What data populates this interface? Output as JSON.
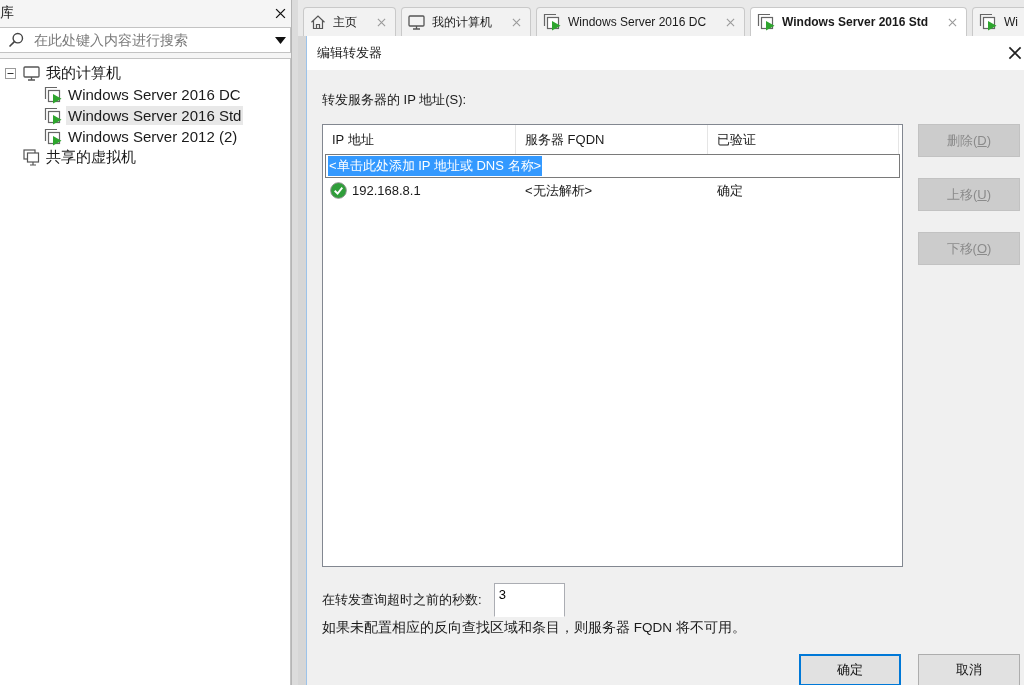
{
  "library_panel": {
    "title": "库",
    "search": {
      "placeholder": "在此处键入内容进行搜索"
    },
    "tree": [
      {
        "label": "我的计算机",
        "kind": "computer",
        "expanded": true,
        "selected": false,
        "children": [
          {
            "label": "Windows Server 2016 DC",
            "kind": "vm",
            "selected": false
          },
          {
            "label": "Windows Server 2016 Std",
            "kind": "vm",
            "selected": true
          },
          {
            "label": "Windows Server 2012 (2)",
            "kind": "vm",
            "selected": false
          }
        ]
      },
      {
        "label": "共享的虚拟机",
        "kind": "shared",
        "selected": false
      }
    ]
  },
  "tabs": [
    {
      "label": "主页",
      "kind": "home",
      "selected": false,
      "closable": true
    },
    {
      "label": "我的计算机",
      "kind": "computer",
      "selected": false,
      "closable": true
    },
    {
      "label": "Windows Server 2016 DC",
      "kind": "vm",
      "selected": false,
      "closable": true
    },
    {
      "label": "Windows Server 2016 Std",
      "kind": "vm",
      "selected": true,
      "closable": true
    },
    {
      "label": "Wi",
      "kind": "vm",
      "selected": false
    }
  ],
  "dialog": {
    "title": "编辑转发器",
    "list_label": "转发服务器的 IP 地址(S):",
    "columns": [
      "IP 地址",
      "服务器 FQDN",
      "已验证"
    ],
    "new_entry": {
      "value": "<单击此处添加 IP 地址或 DNS 名称>",
      "selected": true
    },
    "rows": [
      {
        "ip": "192.168.8.1",
        "fqdn": "<无法解析>",
        "verified": "确定",
        "valid": true
      }
    ],
    "side_buttons": [
      {
        "text": "删除(",
        "access_key": "D",
        "text_end": ")",
        "disabled": true
      },
      {
        "text": "上移(",
        "access_key": "U",
        "text_end": ")",
        "disabled": true
      },
      {
        "text": "下移(",
        "access_key": "O",
        "text_end": ")",
        "disabled": true
      }
    ],
    "timeout": {
      "label": "在转发查询超时之前的秒数:",
      "value": "3"
    },
    "note": "如果未配置相应的反向查找区域和条目，则服务器 FQDN 将不可用。",
    "buttons": [
      {
        "label": "确定",
        "default": true
      },
      {
        "label": "取消",
        "default": false
      }
    ]
  }
}
